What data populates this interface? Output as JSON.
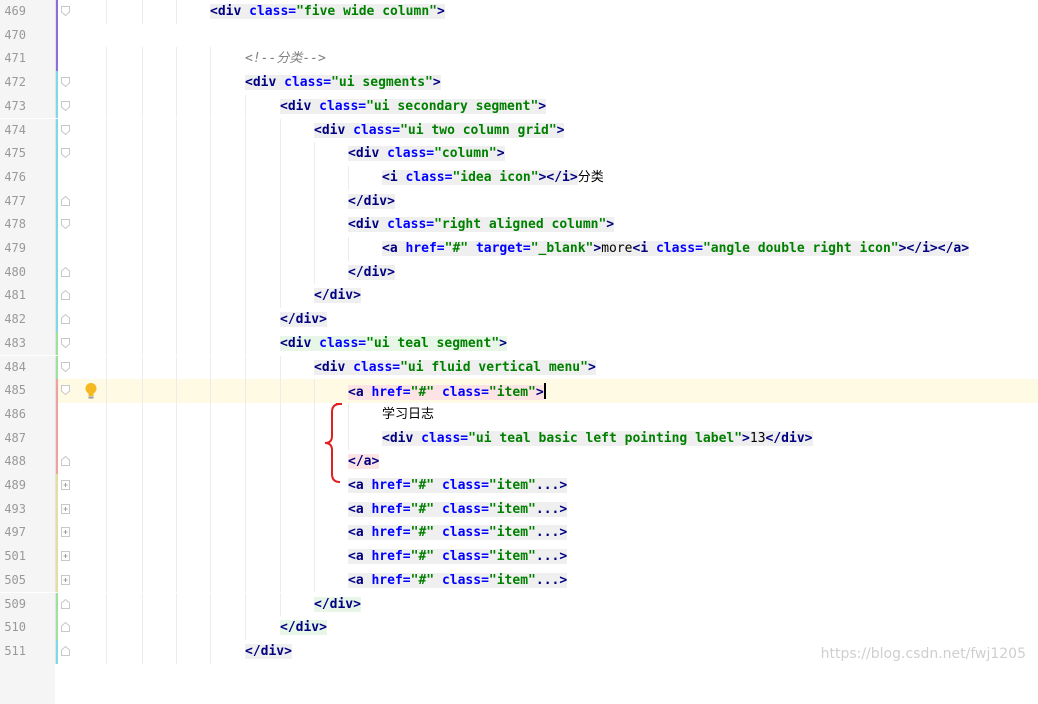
{
  "editor": {
    "lines": [
      {
        "no": "469",
        "code": [
          {
            "t": "tag",
            "s": "<div "
          },
          {
            "t": "attr",
            "s": "class="
          },
          {
            "t": "val",
            "s": "\"five wide column\""
          },
          {
            "t": "tag",
            "s": ">"
          }
        ]
      },
      {
        "no": "470",
        "code": []
      },
      {
        "no": "471",
        "code": [
          {
            "t": "cmt",
            "s": "<!--"
          },
          {
            "t": "cmt cjk",
            "s": "分类"
          },
          {
            "t": "cmt",
            "s": "-->"
          }
        ]
      },
      {
        "no": "472",
        "code": [
          {
            "t": "tag",
            "s": "<div "
          },
          {
            "t": "attr",
            "s": "class="
          },
          {
            "t": "val",
            "s": "\"ui segments\""
          },
          {
            "t": "tag",
            "s": ">"
          }
        ]
      },
      {
        "no": "473",
        "code": [
          {
            "t": "tag",
            "s": "<div "
          },
          {
            "t": "attr",
            "s": "class="
          },
          {
            "t": "val",
            "s": "\"ui secondary segment\""
          },
          {
            "t": "tag",
            "s": ">"
          }
        ]
      },
      {
        "no": "474",
        "code": [
          {
            "t": "tag",
            "s": "<div "
          },
          {
            "t": "attr",
            "s": "class="
          },
          {
            "t": "val",
            "s": "\"ui two column grid\""
          },
          {
            "t": "tag",
            "s": ">"
          }
        ]
      },
      {
        "no": "475",
        "code": [
          {
            "t": "tag",
            "s": "<div "
          },
          {
            "t": "attr",
            "s": "class="
          },
          {
            "t": "val",
            "s": "\"column\""
          },
          {
            "t": "tag",
            "s": ">"
          }
        ]
      },
      {
        "no": "476",
        "code": [
          {
            "t": "tag",
            "s": "<i "
          },
          {
            "t": "attr",
            "s": "class="
          },
          {
            "t": "val",
            "s": "\"idea icon\""
          },
          {
            "t": "tag",
            "s": "></i>"
          },
          {
            "t": "cjk",
            "s": "分类"
          }
        ]
      },
      {
        "no": "477",
        "code": [
          {
            "t": "tag",
            "s": "</div>"
          }
        ]
      },
      {
        "no": "478",
        "code": [
          {
            "t": "tag",
            "s": "<div "
          },
          {
            "t": "attr",
            "s": "class="
          },
          {
            "t": "val",
            "s": "\"right aligned column\""
          },
          {
            "t": "tag",
            "s": ">"
          }
        ]
      },
      {
        "no": "479",
        "code": [
          {
            "t": "tag",
            "s": "<a "
          },
          {
            "t": "attr",
            "s": "href="
          },
          {
            "t": "val",
            "s": "\"#\" "
          },
          {
            "t": "attr",
            "s": "target="
          },
          {
            "t": "val",
            "s": "\"_blank\""
          },
          {
            "t": "tag",
            "s": ">"
          },
          {
            "t": "",
            "s": "more"
          },
          {
            "t": "tag",
            "s": "<i "
          },
          {
            "t": "attr",
            "s": "class="
          },
          {
            "t": "val",
            "s": "\"angle double right icon\""
          },
          {
            "t": "tag",
            "s": "></i></a>"
          }
        ]
      },
      {
        "no": "480",
        "code": [
          {
            "t": "tag",
            "s": "</div>"
          }
        ]
      },
      {
        "no": "481",
        "code": [
          {
            "t": "tag",
            "s": "</div>"
          }
        ]
      },
      {
        "no": "482",
        "code": [
          {
            "t": "tag",
            "s": "</div>"
          }
        ]
      },
      {
        "no": "483",
        "code": [
          {
            "t": "tag",
            "s": "<div "
          },
          {
            "t": "attr",
            "s": "class="
          },
          {
            "t": "val",
            "s": "\"ui teal segment\""
          },
          {
            "t": "tag",
            "s": ">"
          }
        ]
      },
      {
        "no": "484",
        "code": [
          {
            "t": "tag",
            "s": "<div "
          },
          {
            "t": "attr",
            "s": "class="
          },
          {
            "t": "val",
            "s": "\"ui fluid vertical menu\""
          },
          {
            "t": "tag",
            "s": ">"
          }
        ]
      },
      {
        "no": "485",
        "code": [
          {
            "t": "tag",
            "s": "<a "
          },
          {
            "t": "attr",
            "s": "href="
          },
          {
            "t": "val",
            "s": "\"#\" "
          },
          {
            "t": "attr",
            "s": "class="
          },
          {
            "t": "val",
            "s": "\"item\""
          },
          {
            "t": "tag",
            "s": ">"
          }
        ]
      },
      {
        "no": "486",
        "code": [
          {
            "t": "cjk",
            "s": "学习日志"
          }
        ]
      },
      {
        "no": "487",
        "code": [
          {
            "t": "tag",
            "s": "<div "
          },
          {
            "t": "attr",
            "s": "class="
          },
          {
            "t": "val",
            "s": "\"ui teal basic left pointing label\""
          },
          {
            "t": "tag",
            "s": ">"
          },
          {
            "t": "",
            "s": "13"
          },
          {
            "t": "tag",
            "s": "</div>"
          }
        ]
      },
      {
        "no": "488",
        "code": [
          {
            "t": "tag",
            "s": "</a>"
          }
        ]
      },
      {
        "no": "489",
        "code": [
          {
            "t": "tag",
            "s": "<a "
          },
          {
            "t": "attr",
            "s": "href="
          },
          {
            "t": "val",
            "s": "\"#\" "
          },
          {
            "t": "attr",
            "s": "class="
          },
          {
            "t": "val",
            "s": "\"item\""
          },
          {
            "t": "tag",
            "s": "..."
          },
          {
            "t": "tag",
            "s": ">"
          }
        ]
      },
      {
        "no": "493",
        "code": [
          {
            "t": "tag",
            "s": "<a "
          },
          {
            "t": "attr",
            "s": "href="
          },
          {
            "t": "val",
            "s": "\"#\" "
          },
          {
            "t": "attr",
            "s": "class="
          },
          {
            "t": "val",
            "s": "\"item\""
          },
          {
            "t": "tag",
            "s": "..."
          },
          {
            "t": "tag",
            "s": ">"
          }
        ]
      },
      {
        "no": "497",
        "code": [
          {
            "t": "tag",
            "s": "<a "
          },
          {
            "t": "attr",
            "s": "href="
          },
          {
            "t": "val",
            "s": "\"#\" "
          },
          {
            "t": "attr",
            "s": "class="
          },
          {
            "t": "val",
            "s": "\"item\""
          },
          {
            "t": "tag",
            "s": "..."
          },
          {
            "t": "tag",
            "s": ">"
          }
        ]
      },
      {
        "no": "501",
        "code": [
          {
            "t": "tag",
            "s": "<a "
          },
          {
            "t": "attr",
            "s": "href="
          },
          {
            "t": "val",
            "s": "\"#\" "
          },
          {
            "t": "attr",
            "s": "class="
          },
          {
            "t": "val",
            "s": "\"item\""
          },
          {
            "t": "tag",
            "s": "..."
          },
          {
            "t": "tag",
            "s": ">"
          }
        ]
      },
      {
        "no": "505",
        "code": [
          {
            "t": "tag",
            "s": "<a "
          },
          {
            "t": "attr",
            "s": "href="
          },
          {
            "t": "val",
            "s": "\"#\" "
          },
          {
            "t": "attr",
            "s": "class="
          },
          {
            "t": "val",
            "s": "\"item\""
          },
          {
            "t": "tag",
            "s": "..."
          },
          {
            "t": "tag",
            "s": ">"
          }
        ]
      },
      {
        "no": "509",
        "code": [
          {
            "t": "tag",
            "s": "</div>"
          }
        ]
      },
      {
        "no": "510",
        "code": [
          {
            "t": "tag",
            "s": "</div>"
          }
        ]
      },
      {
        "no": "511",
        "code": [
          {
            "t": "tag",
            "s": "</div>"
          }
        ]
      }
    ],
    "current_line": "485",
    "gutter_icon": "lightbulb-icon",
    "fold_icon": "fold-marker-icon",
    "colors": {
      "tag": "#000080",
      "attr": "#0000ff",
      "value": "#008000",
      "comment": "#808080",
      "current_line": "#fffae3",
      "brace": "#e02020"
    }
  },
  "watermark": "https://blog.csdn.net/fwj1205"
}
